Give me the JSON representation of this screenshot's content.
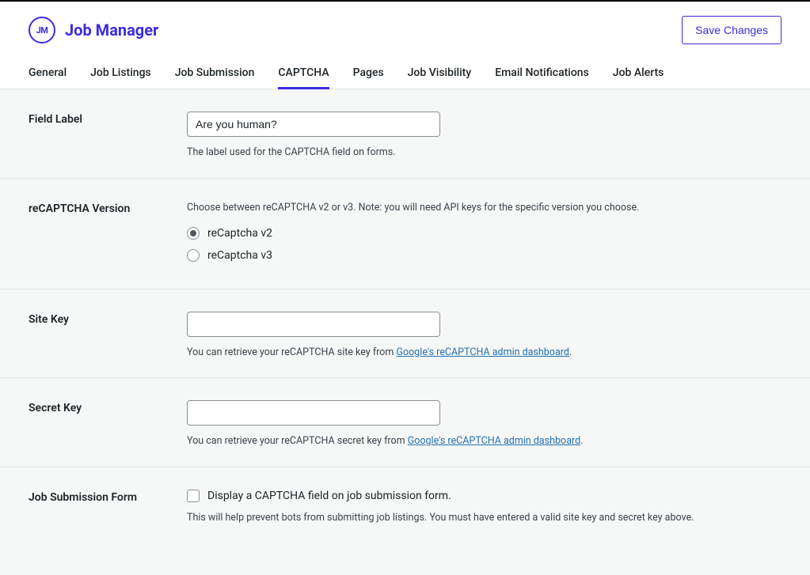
{
  "brand": {
    "logo_text": "JM",
    "title": "Job Manager"
  },
  "header": {
    "save_button": "Save Changes"
  },
  "tabs": [
    {
      "label": "General",
      "active": false
    },
    {
      "label": "Job Listings",
      "active": false
    },
    {
      "label": "Job Submission",
      "active": false
    },
    {
      "label": "CAPTCHA",
      "active": true
    },
    {
      "label": "Pages",
      "active": false
    },
    {
      "label": "Job Visibility",
      "active": false
    },
    {
      "label": "Email Notifications",
      "active": false
    },
    {
      "label": "Job Alerts",
      "active": false
    }
  ],
  "fields": {
    "field_label": {
      "label": "Field Label",
      "value": "Are you human?",
      "help": "The label used for the CAPTCHA field on forms."
    },
    "recaptcha_version": {
      "label": "reCAPTCHA Version",
      "description": "Choose between reCAPTCHA v2 or v3. Note: you will need API keys for the specific version you choose.",
      "options": [
        {
          "label": "reCaptcha v2",
          "checked": true
        },
        {
          "label": "reCaptcha v3",
          "checked": false
        }
      ]
    },
    "site_key": {
      "label": "Site Key",
      "value": "",
      "help_prefix": "You can retrieve your reCAPTCHA site key from ",
      "help_link_text": "Google's reCAPTCHA admin dashboard",
      "help_suffix": "."
    },
    "secret_key": {
      "label": "Secret Key",
      "value": "",
      "help_prefix": "You can retrieve your reCAPTCHA secret key from ",
      "help_link_text": "Google's reCAPTCHA admin dashboard",
      "help_suffix": "."
    },
    "job_submission_form": {
      "label": "Job Submission Form",
      "checkbox_label": "Display a CAPTCHA field on job submission form.",
      "checked": false,
      "help": "This will help prevent bots from submitting job listings. You must have entered a valid site key and secret key above."
    }
  }
}
